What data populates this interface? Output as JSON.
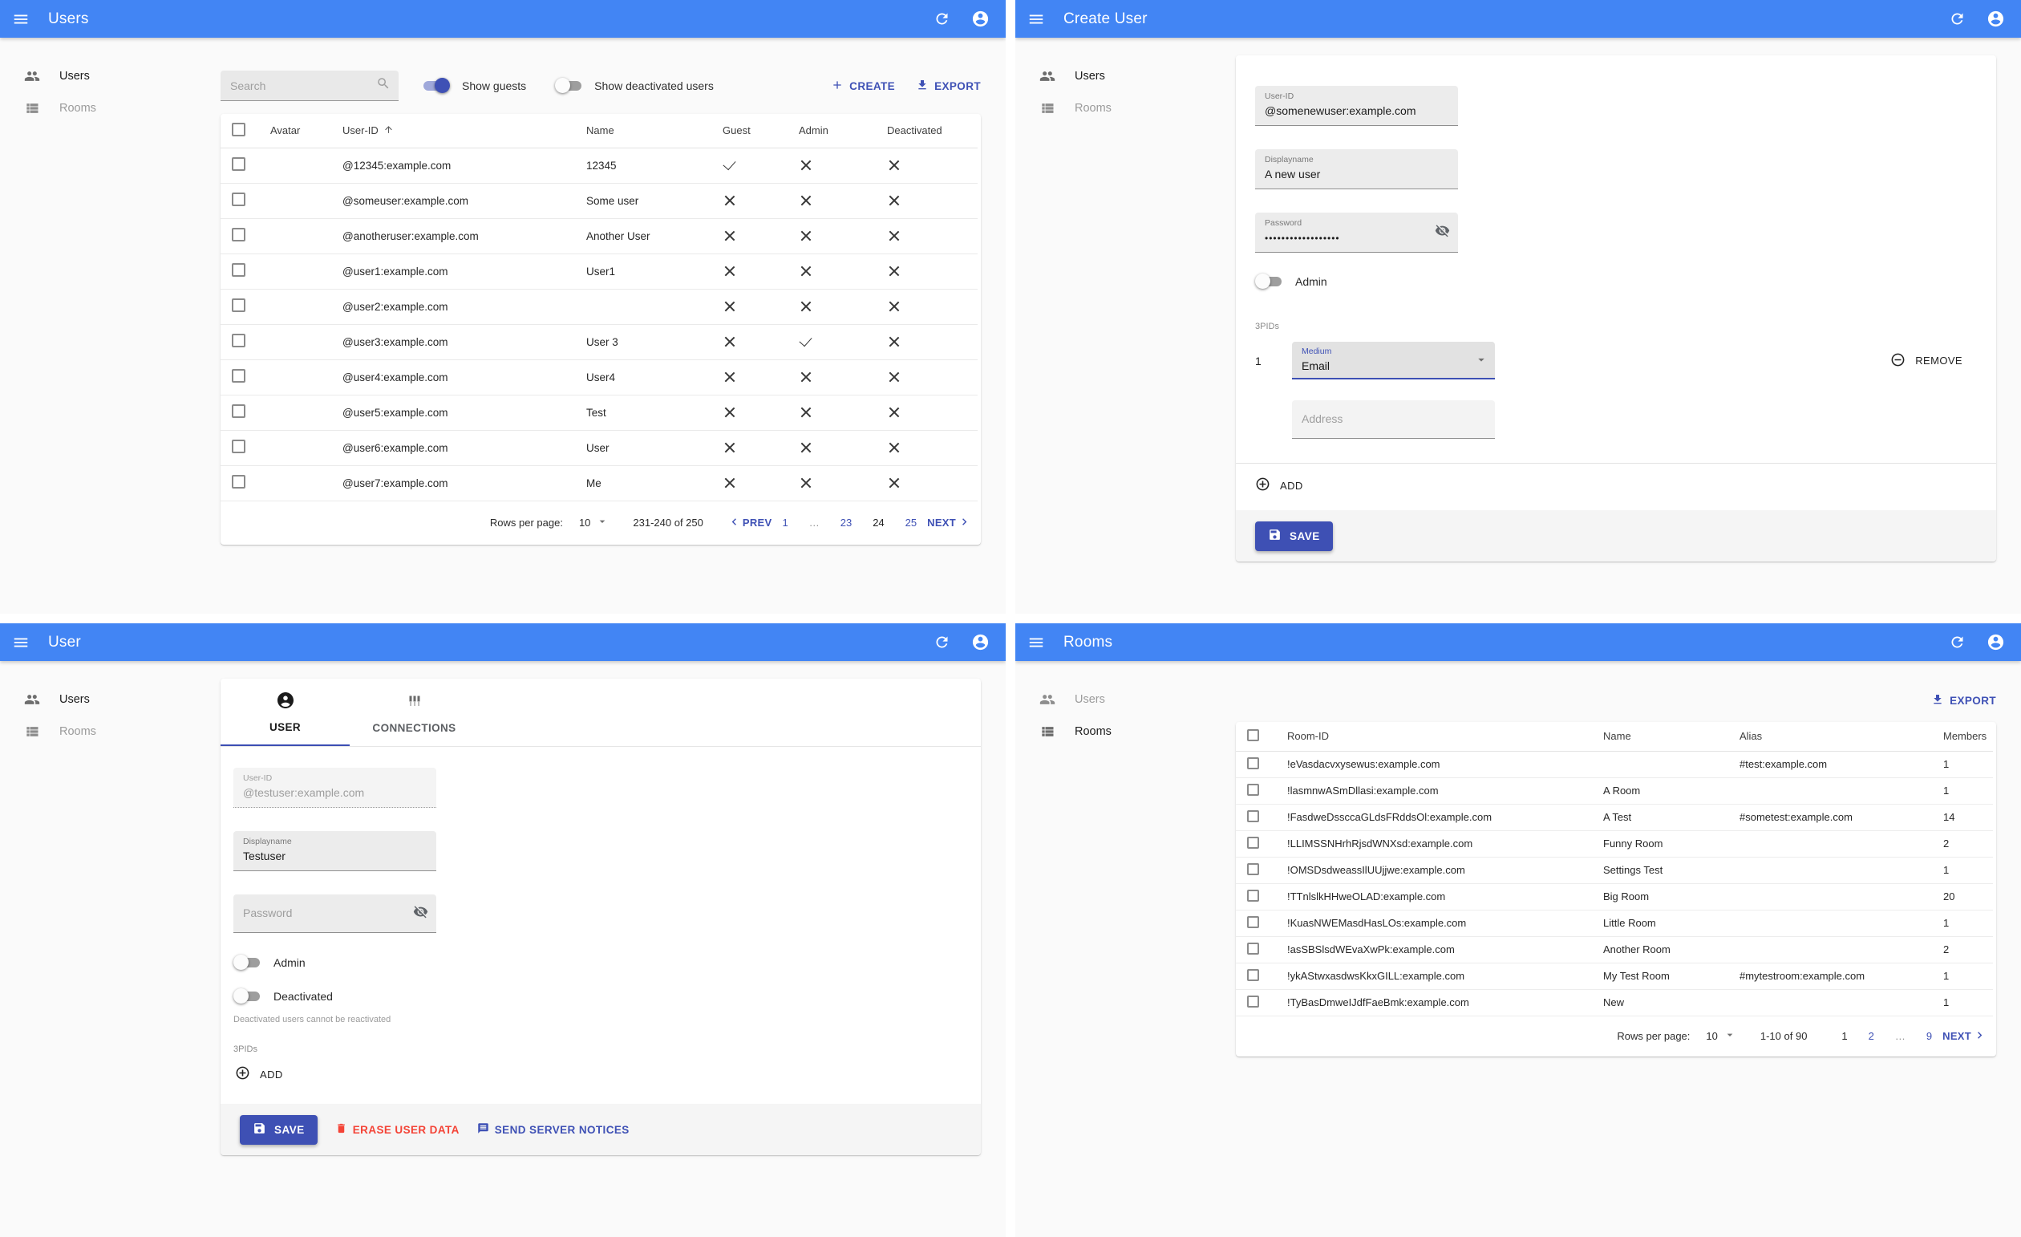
{
  "colors": {
    "appbar": "#4285f4",
    "primary": "#3f51b5",
    "danger": "#f44336"
  },
  "users_list": {
    "title": "Users",
    "sidebar": [
      {
        "label": "Users"
      },
      {
        "label": "Rooms"
      }
    ],
    "search_placeholder": "Search",
    "toggles": {
      "show_guests": "Show guests",
      "show_deactivated": "Show deactivated users"
    },
    "actions": {
      "create": "CREATE",
      "export": "EXPORT"
    },
    "table": {
      "headers": {
        "avatar": "Avatar",
        "user_id": "User-ID",
        "name": "Name",
        "guest": "Guest",
        "admin": "Admin",
        "deactivated": "Deactivated"
      },
      "rows": [
        {
          "user_id": "@12345:example.com",
          "name": "12345",
          "guest": true,
          "admin": false,
          "deactivated": false
        },
        {
          "user_id": "@someuser:example.com",
          "name": "Some user",
          "guest": false,
          "admin": false,
          "deactivated": false
        },
        {
          "user_id": "@anotheruser:example.com",
          "name": "Another User",
          "guest": false,
          "admin": false,
          "deactivated": false
        },
        {
          "user_id": "@user1:example.com",
          "name": "User1",
          "guest": false,
          "admin": false,
          "deactivated": false
        },
        {
          "user_id": "@user2:example.com",
          "name": "",
          "guest": false,
          "admin": false,
          "deactivated": false
        },
        {
          "user_id": "@user3:example.com",
          "name": "User 3",
          "guest": false,
          "admin": true,
          "deactivated": false
        },
        {
          "user_id": "@user4:example.com",
          "name": "User4",
          "guest": false,
          "admin": false,
          "deactivated": false
        },
        {
          "user_id": "@user5:example.com",
          "name": "Test",
          "guest": false,
          "admin": false,
          "deactivated": false
        },
        {
          "user_id": "@user6:example.com",
          "name": "User",
          "guest": false,
          "admin": false,
          "deactivated": false
        },
        {
          "user_id": "@user7:example.com",
          "name": "Me",
          "guest": false,
          "admin": false,
          "deactivated": false
        }
      ]
    },
    "pagination": {
      "rows_per_page_label": "Rows per page:",
      "rows_per_page": "10",
      "range": "231-240 of 250",
      "prev": "PREV",
      "next": "NEXT",
      "pages": [
        "1",
        "…",
        "23",
        "24",
        "25"
      ]
    }
  },
  "create_user": {
    "title": "Create User",
    "sidebar": [
      {
        "label": "Users"
      },
      {
        "label": "Rooms"
      }
    ],
    "fields": {
      "user_id": {
        "label": "User-ID",
        "value": "@somenewuser:example.com"
      },
      "displayname": {
        "label": "Displayname",
        "value": "A new user"
      },
      "password": {
        "label": "Password",
        "value": "••••••••••••••••••"
      },
      "admin_label": "Admin",
      "threepids_label": "3PIDs",
      "pid_index": "1",
      "medium": {
        "label": "Medium",
        "value": "Email"
      },
      "address_placeholder": "Address",
      "remove": "REMOVE",
      "add": "ADD",
      "save": "SAVE"
    }
  },
  "user_edit": {
    "title": "User",
    "sidebar": [
      {
        "label": "Users"
      },
      {
        "label": "Rooms"
      }
    ],
    "tabs": {
      "user": "USER",
      "connections": "CONNECTIONS"
    },
    "fields": {
      "user_id": {
        "label": "User-ID",
        "value": "@testuser:example.com"
      },
      "displayname": {
        "label": "Displayname",
        "value": "Testuser"
      },
      "password_placeholder": "Password",
      "admin_label": "Admin",
      "deactivated_label": "Deactivated",
      "deactivated_help": "Deactivated users cannot be reactivated",
      "threepids_label": "3PIDs",
      "add": "ADD"
    },
    "footer": {
      "save": "SAVE",
      "erase": "ERASE USER DATA",
      "notices": "SEND SERVER NOTICES"
    }
  },
  "rooms_list": {
    "title": "Rooms",
    "sidebar": [
      {
        "label": "Users"
      },
      {
        "label": "Rooms"
      }
    ],
    "export_label": "EXPORT",
    "table": {
      "headers": {
        "room_id": "Room-ID",
        "name": "Name",
        "alias": "Alias",
        "members": "Members"
      },
      "rows": [
        {
          "room_id": "!eVasdacvxysewus:example.com",
          "name": "",
          "alias": "#test:example.com",
          "members": "1"
        },
        {
          "room_id": "!lasmnwASmDllasi:example.com",
          "name": "A Room",
          "alias": "",
          "members": "1"
        },
        {
          "room_id": "!FasdweDssccaGLdsFRddsOl:example.com",
          "name": "A Test",
          "alias": "#sometest:example.com",
          "members": "14"
        },
        {
          "room_id": "!LLIMSSNHrhRjsdWNXsd:example.com",
          "name": "Funny Room",
          "alias": "",
          "members": "2"
        },
        {
          "room_id": "!OMSDsdweassIlUUjjwe:example.com",
          "name": "Settings Test",
          "alias": "",
          "members": "1"
        },
        {
          "room_id": "!TTnlslkHHweOLAD:example.com",
          "name": "Big Room",
          "alias": "",
          "members": "20"
        },
        {
          "room_id": "!KuasNWEMasdHasLOs:example.com",
          "name": "Little Room",
          "alias": "",
          "members": "1"
        },
        {
          "room_id": "!asSBSlsdWEvaXwPk:example.com",
          "name": "Another Room",
          "alias": "",
          "members": "2"
        },
        {
          "room_id": "!ykAStwxasdwsKkxGILL:example.com",
          "name": "My Test Room",
          "alias": "#mytestroom:example.com",
          "members": "1"
        },
        {
          "room_id": "!TyBasDmweIJdfFaeBmk:example.com",
          "name": "New",
          "alias": "",
          "members": "1"
        }
      ]
    },
    "pagination": {
      "rows_per_page_label": "Rows per page:",
      "rows_per_page": "10",
      "range": "1-10 of 90",
      "next": "NEXT",
      "pages": [
        "1",
        "2",
        "…",
        "9"
      ]
    }
  }
}
